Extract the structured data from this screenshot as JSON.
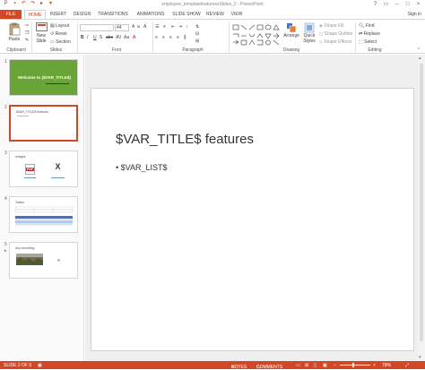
{
  "window": {
    "title": "employee_templatefeaturesxSlides_2 - PowerPoint",
    "controls": [
      "?",
      "▭",
      "–",
      "□",
      "×"
    ]
  },
  "tabs": {
    "file": "FILE",
    "items": [
      "HOME",
      "INSERT",
      "DESIGN",
      "TRANSITIONS",
      "ANIMATIONS",
      "SLIDE SHOW",
      "REVIEW",
      "VIEW"
    ],
    "active": "HOME",
    "sign_in": "Sign in"
  },
  "ribbon": {
    "clipboard": {
      "paste": "Paste",
      "label": "Clipboard"
    },
    "slides": {
      "new_slide": "New Slide",
      "layout": "Layout",
      "reset": "Reset",
      "section": "Section",
      "label": "Slides"
    },
    "font": {
      "size": "44",
      "label": "Font"
    },
    "paragraph": {
      "label": "Paragraph"
    },
    "drawing": {
      "arrange": "Arrange",
      "quick_styles": "Quick Styles",
      "shape_fill": "Shape Fill",
      "shape_outline": "Shape Outline",
      "shape_effects": "Shape Effects",
      "label": "Drawing"
    },
    "editing": {
      "find": "Find",
      "replace": "Replace",
      "select": "Select",
      "label": "Editing"
    }
  },
  "thumbnails": [
    {
      "number": "1",
      "title": "Welcome to {$VAR_TITLE$}",
      "bg": "#6aa338"
    },
    {
      "number": "2",
      "title": "$VAR_TITLE$ features",
      "bg": "#ffffff",
      "selected": true
    },
    {
      "number": "3",
      "title": "Images",
      "bg": "#ffffff"
    },
    {
      "number": "4",
      "title": "Tables",
      "bg": "#ffffff"
    },
    {
      "number": "5",
      "title": "Any thumbing",
      "bg": "#ffffff",
      "star": "★"
    }
  ],
  "thumb3": {
    "pdf_label": "PDF",
    "x_label": "X"
  },
  "slide": {
    "title": "$VAR_TITLE$ features",
    "bullet": "• $VAR_LIST$"
  },
  "status": {
    "slide_info": "SLIDE 2 OF 5",
    "notes": "NOTES",
    "comments": "COMMENTS",
    "zoom": "78%"
  },
  "colors": {
    "accent": "#d24726",
    "slide1_green": "#6aa338"
  }
}
